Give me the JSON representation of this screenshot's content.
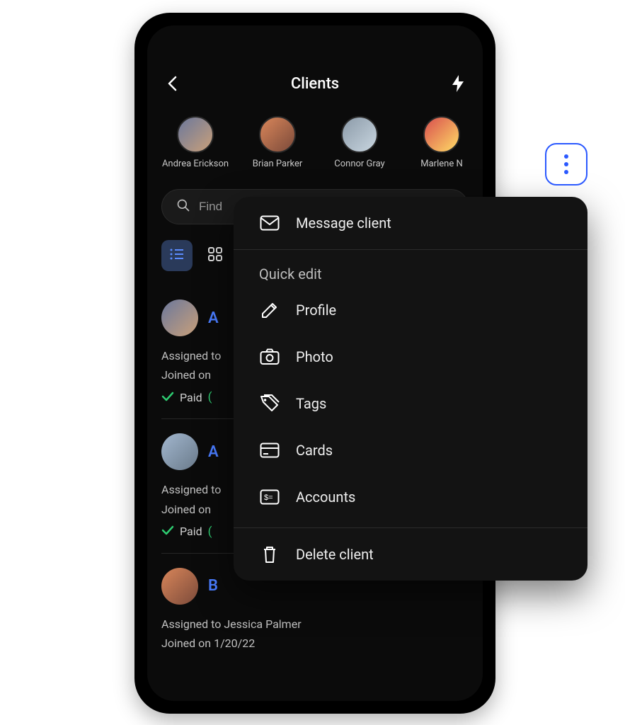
{
  "header": {
    "title": "Clients"
  },
  "avatars": [
    {
      "name": "Andrea Erickson"
    },
    {
      "name": "Brian Parker"
    },
    {
      "name": "Connor Gray"
    },
    {
      "name": "Marlene N"
    }
  ],
  "search": {
    "placeholder": "Find"
  },
  "clients": [
    {
      "initial": "A",
      "assigned": "Assigned to",
      "joined": "Joined on",
      "paid": "Paid"
    },
    {
      "initial": "A",
      "assigned": "Assigned to",
      "joined": "Joined on",
      "paid": "Paid"
    },
    {
      "initial": "B",
      "assigned": "Assigned to Jessica Palmer",
      "joined": "Joined on 1/20/22"
    }
  ],
  "menu": {
    "message": "Message client",
    "section_label": "Quick edit",
    "items": [
      {
        "label": "Profile",
        "icon": "pencil"
      },
      {
        "label": "Photo",
        "icon": "camera"
      },
      {
        "label": "Tags",
        "icon": "tag"
      },
      {
        "label": "Cards",
        "icon": "card"
      },
      {
        "label": "Accounts",
        "icon": "accounts"
      }
    ],
    "delete": "Delete client"
  }
}
